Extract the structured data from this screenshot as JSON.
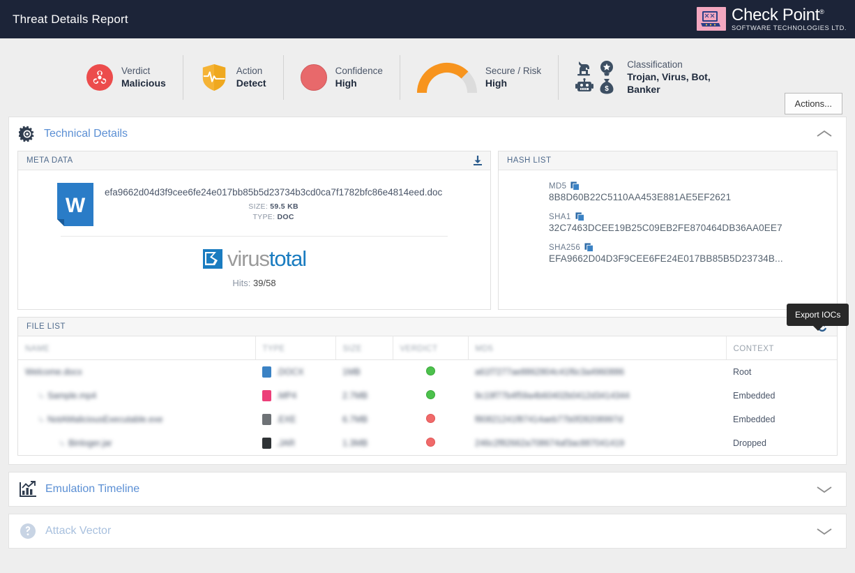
{
  "header": {
    "title": "Threat Details Report",
    "logo": {
      "name": "Check Point",
      "registered": "®",
      "tagline": "SOFTWARE TECHNOLOGIES LTD."
    }
  },
  "summary": {
    "items": [
      {
        "icon": "biohazard-icon",
        "label": "Verdict",
        "value": "Malicious"
      },
      {
        "icon": "shield-pulse-icon",
        "label": "Action",
        "value": "Detect"
      },
      {
        "icon": "confidence-circle-icon",
        "label": "Confidence",
        "value": "High"
      },
      {
        "icon": "risk-gauge-icon",
        "label": "Secure / Risk",
        "value": "High"
      },
      {
        "icon": "classification-icons",
        "label": "Classification",
        "value": "Trojan, Virus, Bot, Banker"
      }
    ],
    "gauge": {
      "fill_percent": 75,
      "fill_color": "#f7941e",
      "track_color": "#dcdcdc"
    },
    "actions_button": "Actions..."
  },
  "technical_details": {
    "title": "Technical Details",
    "icon": "gear-icon",
    "collapse_icon": "chevron-up-icon",
    "meta_data": {
      "panel_title": "META DATA",
      "download_icon": "download-icon",
      "file_icon": "word-doc-icon",
      "file_name": "efa9662d04d3f9cee6fe24e017bb85b5d23734b3cd0ca7f1782bfc86e4814eed.doc",
      "size_label": "SIZE:",
      "size_value": "59.5 KB",
      "type_label": "TYPE:",
      "type_value": "DOC",
      "virustotal": {
        "logo_text_1": "virus",
        "logo_text_2": "total",
        "hits_label": "Hits:",
        "hits_value": "39/58"
      }
    },
    "hash_list": {
      "panel_title": "HASH LIST",
      "hashes": [
        {
          "label": "MD5",
          "value": "8B8D60B22C5110AA453E881AE5EF2621",
          "copy_icon": "copy-icon"
        },
        {
          "label": "SHA1",
          "value": "32C7463DCEE19B25C09EB2FE870464DB36AA0EE7",
          "copy_icon": "copy-icon"
        },
        {
          "label": "SHA256",
          "value": "EFA9662D04D3F9CEE6FE24E017BB85B5D23734B...",
          "copy_icon": "copy-icon"
        }
      ]
    },
    "file_list": {
      "panel_title": "FILE LIST",
      "export_icon": "export-ioc-icon",
      "tooltip": "Export IOCs",
      "columns": [
        "NAME",
        "TYPE",
        "SIZE",
        "VERDICT",
        "MD5",
        "CONTEXT"
      ],
      "rows": [
        {
          "indent": 0,
          "name": "Welcome.docx",
          "type": ".DOCX",
          "type_color": "#3b82c4",
          "size": "1MB",
          "verdict": "green",
          "md5": "a61f7277ae8862804c41f6c3a4960886",
          "context": "Root"
        },
        {
          "indent": 1,
          "name": "Sample.mp4",
          "type": ".MP4",
          "type_color": "#ec3f79",
          "size": "2.7MB",
          "verdict": "green",
          "md5": "9c19f77b4f59a4b60402b0412d3414344",
          "context": "Embedded"
        },
        {
          "indent": 1,
          "name": "NotAMaliciousExecutable.exe",
          "type": ".EXE",
          "type_color": "#6e7276",
          "size": "6.7MB",
          "verdict": "red",
          "md5": "f80821241f87414aeb77b0f28208997d",
          "context": "Embedded"
        },
        {
          "indent": 2,
          "name": "Binloger.jar",
          "type": ".JAR",
          "type_color": "#2f3336",
          "size": "1.3MB",
          "verdict": "red",
          "md5": "246c2f82662a708674af3ac887041419",
          "context": "Dropped"
        }
      ]
    }
  },
  "emulation_timeline": {
    "title": "Emulation Timeline",
    "icon": "chart-trend-icon",
    "collapse_icon": "chevron-down-icon"
  },
  "attack_vector": {
    "title": "Attack Vector",
    "icon": "attack-vector-icon",
    "collapse_icon": "chevron-down-icon"
  },
  "colors": {
    "topbar": "#1c2438",
    "accent_blue": "#5b8fd4",
    "malicious_red": "#ec4c4c",
    "action_orange": "#f5a623",
    "gauge_orange": "#f7941e"
  }
}
